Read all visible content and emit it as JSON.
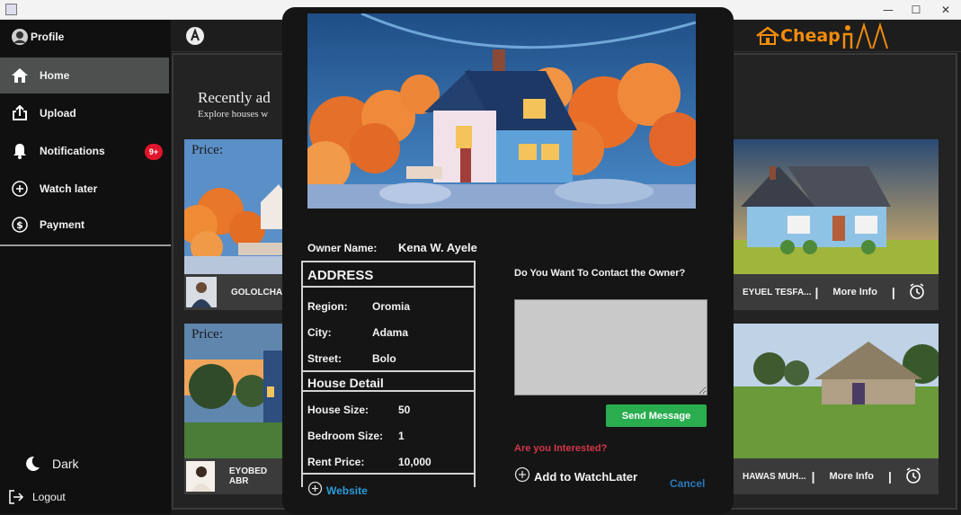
{
  "window": {
    "buttons": [
      "—",
      "☐",
      "✕"
    ]
  },
  "sidebar": {
    "profile": "Profile",
    "items": [
      {
        "label": "Home",
        "icon": "home-icon"
      },
      {
        "label": "Upload",
        "icon": "upload-icon"
      },
      {
        "label": "Notifications",
        "icon": "bell-icon",
        "badge": "9+"
      },
      {
        "label": "Watch later",
        "icon": "plus-circle-icon"
      },
      {
        "label": "Payment",
        "icon": "dollar-circle-icon"
      }
    ],
    "dark_label": "Dark",
    "logout_label": "Logout"
  },
  "brand": {
    "name": "Cheap",
    "color": "#f28c0c"
  },
  "main": {
    "title": "Recent",
    "title_rest": "ly ad",
    "subtitle": "Explore houses w"
  },
  "cards": [
    {
      "price_label": "Price:",
      "owner": "GOLOLCHA"
    },
    {
      "price_label": "Price:",
      "owner": "EYOBED ABR"
    },
    {
      "owner": "EYUEL TESFA...",
      "more": "More Info"
    },
    {
      "owner": "HAWAS MUH...",
      "more": "More Info"
    }
  ],
  "modal": {
    "owner_label": "Owner Name:",
    "owner_value": "Kena W. Ayele",
    "address_header": "ADDRESS",
    "region_label": "Region:",
    "region_value": "Oromia",
    "city_label": "City:",
    "city_value": "Adama",
    "street_label": "Street:",
    "street_value": "Bolo",
    "house_header": "House Detail",
    "size_label": "House Size:",
    "size_value": "50",
    "bedroom_label": "Bedroom Size:",
    "bedroom_value": "1",
    "rent_label": "Rent Price:",
    "rent_value": "10,000",
    "website_label": "Website",
    "contact_question": "Do You Want To Contact the Owner?",
    "message_value": "",
    "send_label": "Send Message",
    "interested_label": "Are you Interested?",
    "watch_label": "Add to WatchLater",
    "cancel_label": "Cancel"
  },
  "colors": {
    "accent_green": "#29ad4f",
    "badge_red": "#e0162b",
    "interested_red": "#d2364a",
    "link_blue": "#2a9ad8"
  }
}
